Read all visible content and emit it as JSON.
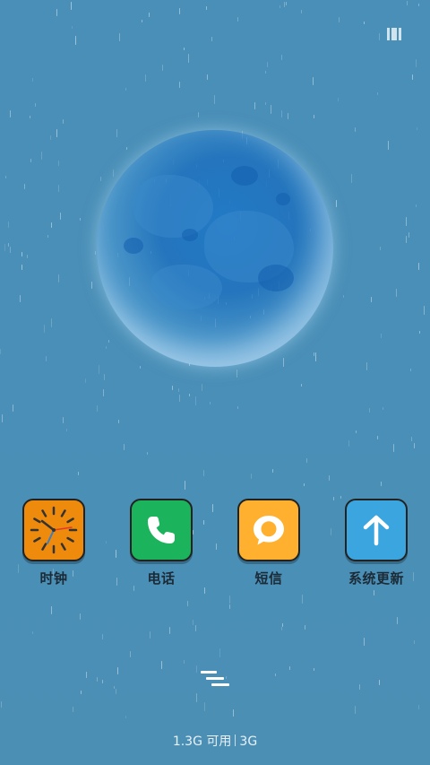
{
  "colors": {
    "wallpaper": "#4a8fb7",
    "clock_tile": "#ee8a0c",
    "phone_tile": "#1bb35c",
    "sms_tile": "#ffb02e",
    "update_tile": "#3aa5df",
    "label_text": "#1c2a36"
  },
  "status_bar": {
    "right_icon": "battery-icon"
  },
  "wallpaper": {
    "subject_icon": "moon-icon"
  },
  "dock": {
    "apps": [
      {
        "label": "时钟",
        "icon": "clock-icon"
      },
      {
        "label": "电话",
        "icon": "phone-icon"
      },
      {
        "label": "短信",
        "icon": "message-bubble-icon"
      },
      {
        "label": "系统更新",
        "icon": "arrow-up-icon"
      }
    ]
  },
  "memory": {
    "free": "1.3G 可用",
    "total": "3G"
  },
  "cleaner": {
    "icon": "memory-clean-icon"
  }
}
